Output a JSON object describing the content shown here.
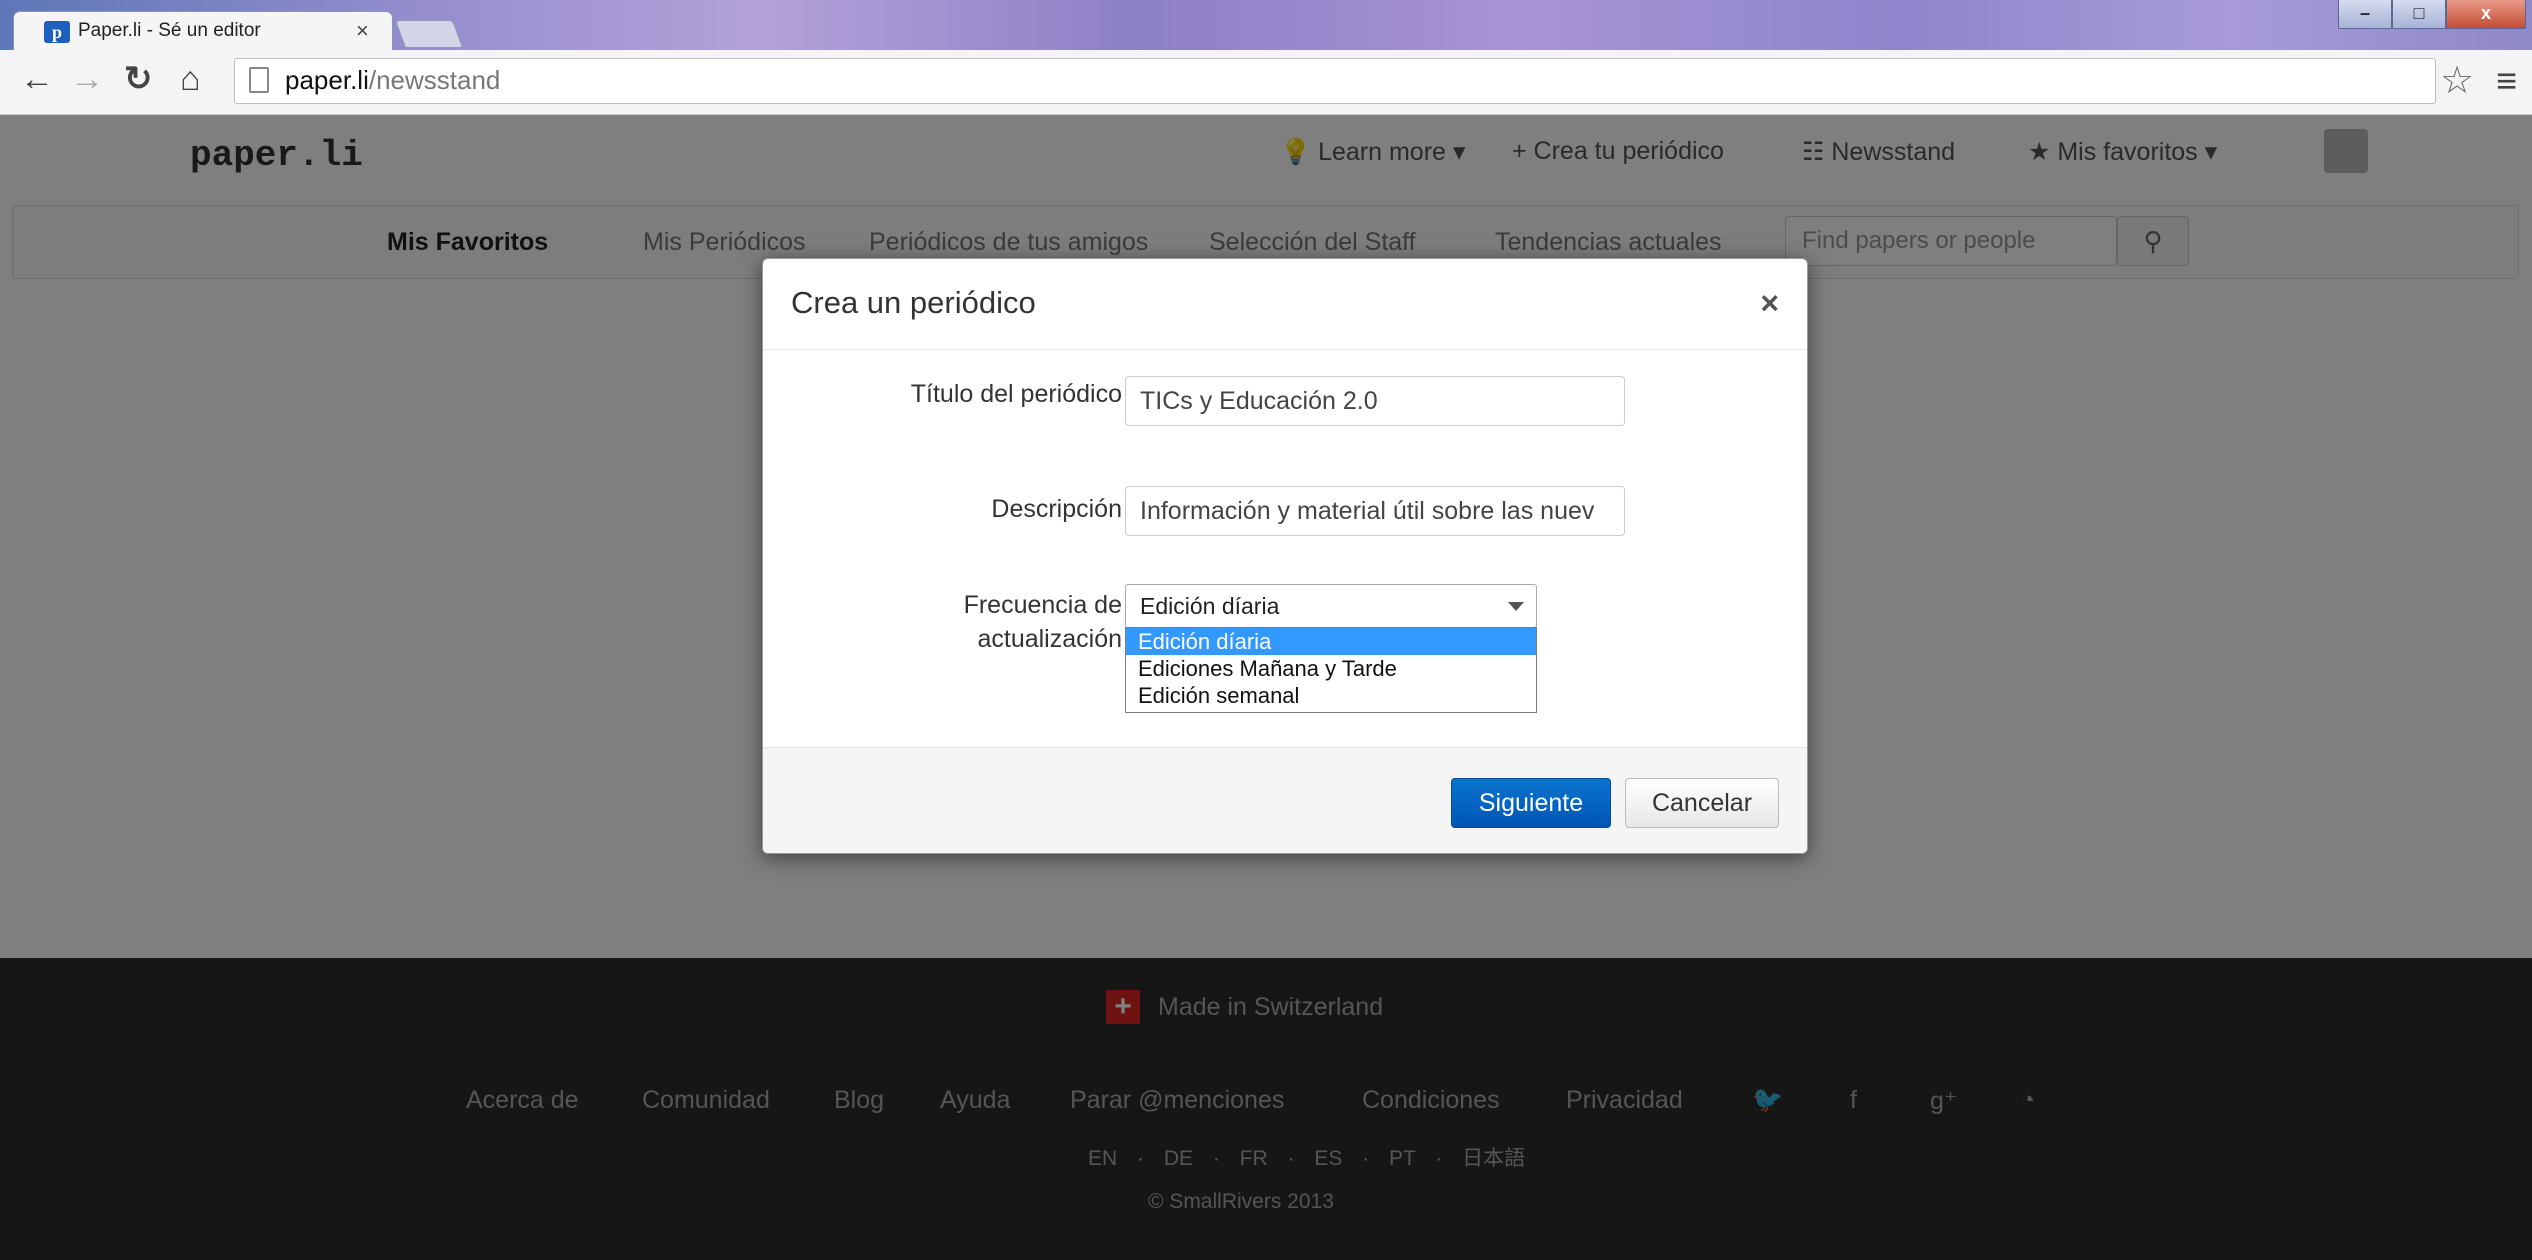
{
  "browser": {
    "tab_title": "Paper.li - Sé un editor",
    "tab_favicon": "p",
    "tab_close": "×",
    "url_host": "paper.li",
    "url_path": "/newsstand"
  },
  "site": {
    "logo": "paper.li",
    "nav": {
      "learn_more": "Learn more ▾",
      "create": "Crea tu periódico",
      "newsstand": "Newsstand",
      "favorites": "Mis favoritos ▾"
    },
    "subnav": {
      "mis_favoritos": "Mis Favoritos",
      "mis_periodicos": "Mis Periódicos",
      "periodicos_amigos": "Periódicos de tus amigos",
      "seleccion_staff": "Selección del Staff",
      "temas_actuales": "Tendencias actuales",
      "search_placeholder": "Find papers or people"
    },
    "footer": {
      "made_in": "Made in Switzerland",
      "links": [
        "Acerca de",
        "Comunidad",
        "Blog",
        "Ayuda",
        "Parar @menciones",
        "Condiciones",
        "Privacidad"
      ],
      "languages": "EN · DE · FR · ES · PT · 日本語",
      "copyright": "© SmallRivers 2013"
    }
  },
  "modal": {
    "title": "Crea un periódico",
    "close": "×",
    "fields": {
      "title_label": "Título del periódico",
      "title_value": "TICs y Educación 2.0",
      "description_label": "Descripción",
      "description_value": "Información y material útil sobre las nuev",
      "frequency_label_1": "Frecuencia de",
      "frequency_label_2": "actualización",
      "frequency_selected": "Edición díaria",
      "frequency_options": [
        "Edición díaria",
        "Ediciones Mañana y Tarde",
        "Edición semanal"
      ]
    },
    "buttons": {
      "next": "Siguiente",
      "cancel": "Cancelar"
    }
  },
  "colors": {
    "primary_button": "#0a6fc9",
    "selected_option": "#3399ff",
    "footer_bg": "#2d2d2d"
  }
}
